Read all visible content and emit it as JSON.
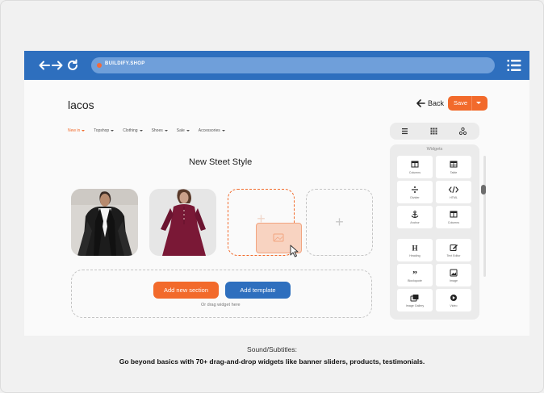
{
  "browser": {
    "url": "BUILDIFY.SHOP"
  },
  "editor": {
    "page_title": "lacos",
    "back_label": "Back",
    "save_label": "Save",
    "section_title": "New Steet Style",
    "add_section_label": "Add new section",
    "add_template_label": "Add template",
    "drag_hint": "Or drag widget here"
  },
  "shop_nav": [
    {
      "label": "New in"
    },
    {
      "label": "Topshop"
    },
    {
      "label": "Clothing"
    },
    {
      "label": "Shoes"
    },
    {
      "label": "Sale"
    },
    {
      "label": "Accessories"
    }
  ],
  "widget_panel": {
    "title": "Widgets",
    "widgets": [
      {
        "label": "Columns",
        "icon": "columns-icon"
      },
      {
        "label": "Table",
        "icon": "table-icon"
      },
      {
        "label": "Divider",
        "icon": "divider-icon"
      },
      {
        "label": "HTML",
        "icon": "code-icon"
      },
      {
        "label": "Anchor",
        "icon": "anchor-icon"
      },
      {
        "label": "Columns",
        "icon": "columns-icon"
      },
      {
        "label": "Heading",
        "icon": "heading-icon"
      },
      {
        "label": "Text Editor",
        "icon": "edit-icon"
      },
      {
        "label": "Blockquote",
        "icon": "quote-icon"
      },
      {
        "label": "Image",
        "icon": "image-icon"
      },
      {
        "label": "Image Gallery",
        "icon": "gallery-icon"
      },
      {
        "label": "Video",
        "icon": "play-icon"
      }
    ]
  },
  "subtitles": {
    "heading": "Sound/Subtitles:",
    "text": "Go beyond basics with 70+ drag-and-drop widgets like banner sliders, products, testimonials."
  },
  "colors": {
    "brand_blue": "#2e6fbe",
    "accent_orange": "#f26a2b"
  }
}
